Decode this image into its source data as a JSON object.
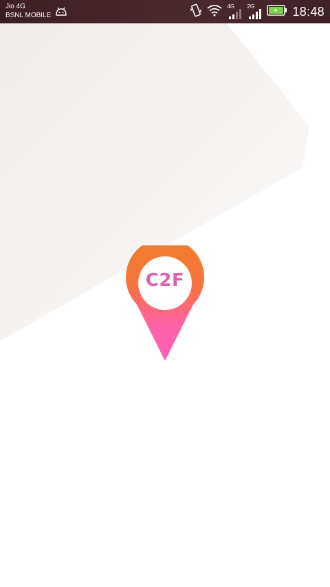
{
  "status_bar": {
    "carrier_1": "Jio 4G",
    "carrier_2": "BSNL MOBILE",
    "network_1_type": "4G",
    "network_2_type": "2G",
    "time": "18:48",
    "icons": [
      "android-debug-icon",
      "vibrate-icon",
      "wifi-icon",
      "signal-4g-icon",
      "signal-2g-icon",
      "battery-charging-icon"
    ]
  },
  "splash": {
    "logo_text": "C2F",
    "logo_icon": "map-pin-icon"
  },
  "colors": {
    "status_bar_bg": "#3f2226",
    "pin_top": "#f07f2a",
    "pin_bottom": "#ff5fb7",
    "logo_text": "#e05fae",
    "background": "#ffffff",
    "shade": "#f3efec",
    "battery_fill": "#7bd44b"
  }
}
